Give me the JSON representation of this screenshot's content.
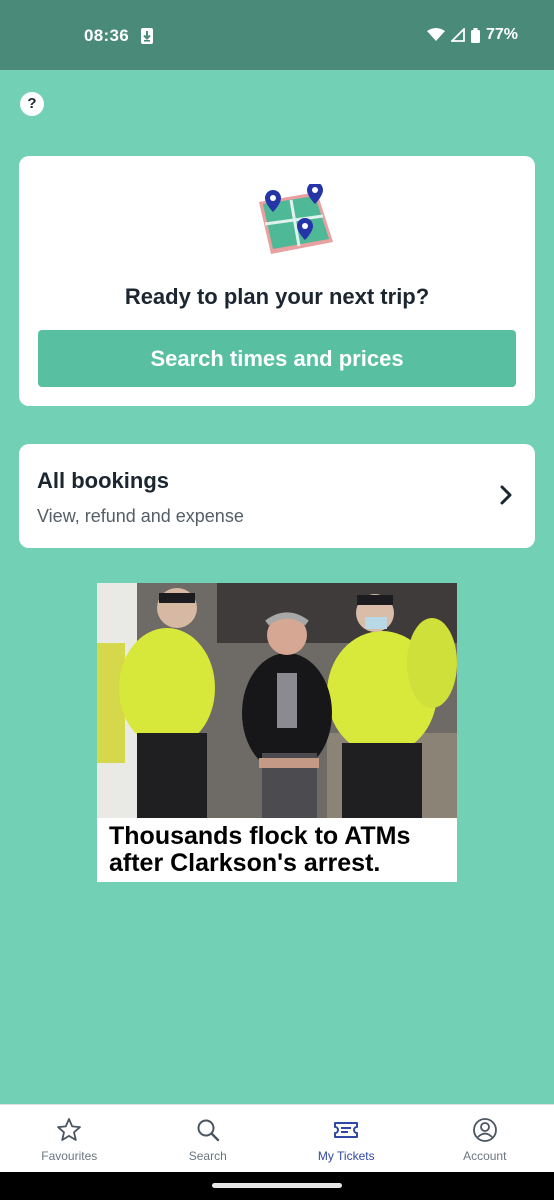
{
  "status_bar": {
    "time": "08:36",
    "battery": "77%"
  },
  "help": {
    "label": "?"
  },
  "plan_card": {
    "title": "Ready to plan your next trip?",
    "button_label": "Search times and prices"
  },
  "bookings": {
    "title": "All bookings",
    "subtitle": "View, refund and expense"
  },
  "promo": {
    "caption": "Thousands flock to ATMs after Clarkson's arrest."
  },
  "bottom_nav": {
    "items": [
      {
        "label": "Favourites",
        "icon": "star-icon"
      },
      {
        "label": "Search",
        "icon": "search-icon"
      },
      {
        "label": "My Tickets",
        "icon": "ticket-icon",
        "active": true
      },
      {
        "label": "Account",
        "icon": "account-icon"
      }
    ]
  },
  "colors": {
    "background": "#72d1b4",
    "status_bar": "#4a8a79",
    "primary_button": "#58c0a0",
    "active_nav": "#3047a6"
  }
}
